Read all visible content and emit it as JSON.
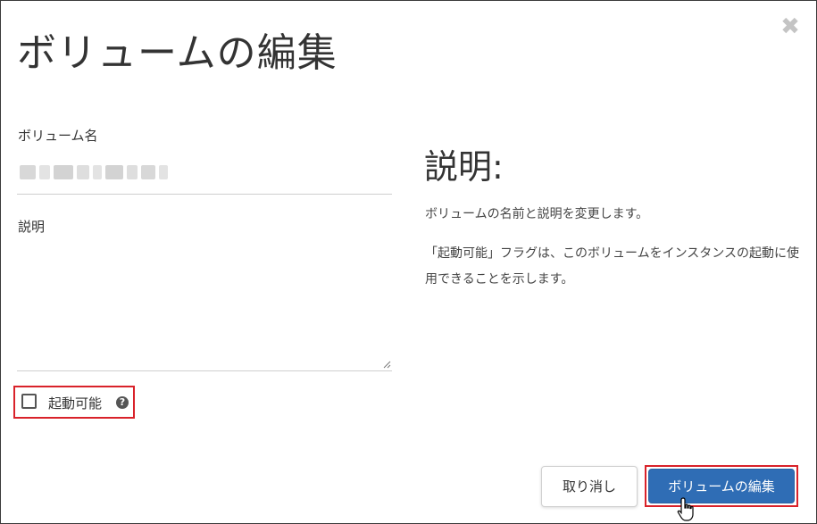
{
  "dialog": {
    "title": "ボリュームの編集",
    "close_glyph": "✖"
  },
  "form": {
    "name_label": "ボリューム名",
    "name_value": "",
    "description_label": "説明",
    "description_value": "",
    "bootable_label": "起動可能",
    "bootable_checked": false,
    "help_glyph": "?"
  },
  "sidebar": {
    "title": "説明:",
    "paragraphs": [
      "ボリュームの名前と説明を変更します。",
      "「起動可能」フラグは、このボリュームをインスタンスの起動に使用できることを示します。"
    ]
  },
  "footer": {
    "cancel_label": "取り消し",
    "submit_label": "ボリュームの編集"
  },
  "colors": {
    "primary": "#2f6db5",
    "highlight": "#d9222a"
  }
}
